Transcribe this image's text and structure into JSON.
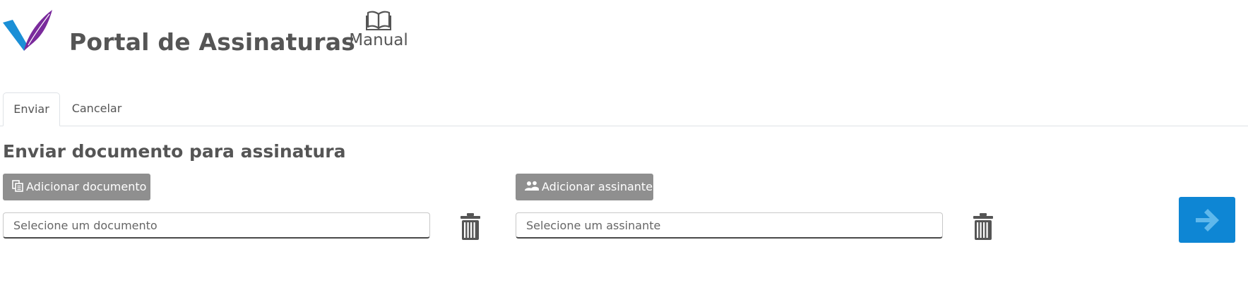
{
  "header": {
    "app_title": "Portal de Assinaturas",
    "manual_label": "Manual",
    "logo_icon": "quill-check-logo",
    "manual_icon": "open-book-icon"
  },
  "tabs": [
    {
      "label": "Enviar",
      "active": true
    },
    {
      "label": "Cancelar",
      "active": false
    }
  ],
  "main": {
    "section_title": "Enviar documento para assinatura",
    "add_document_label": "Adicionar documento",
    "add_document_icon": "copy-documents-icon",
    "add_signer_label": "Adicionar assinante",
    "add_signer_icon": "users-icon",
    "document_field": {
      "value": "",
      "placeholder": "Selecione um documento"
    },
    "signer_field": {
      "value": "",
      "placeholder": "Selecione um assinante"
    },
    "next_icon": "arrow-right-icon"
  },
  "colors": {
    "text": "#555555",
    "button_gray": "#8f8f8f",
    "accent_blue": "#0e86d4",
    "arrow_blue": "#5fb8ec",
    "logo_blue": "#1a8fd6",
    "logo_purple": "#7a2a9c"
  }
}
